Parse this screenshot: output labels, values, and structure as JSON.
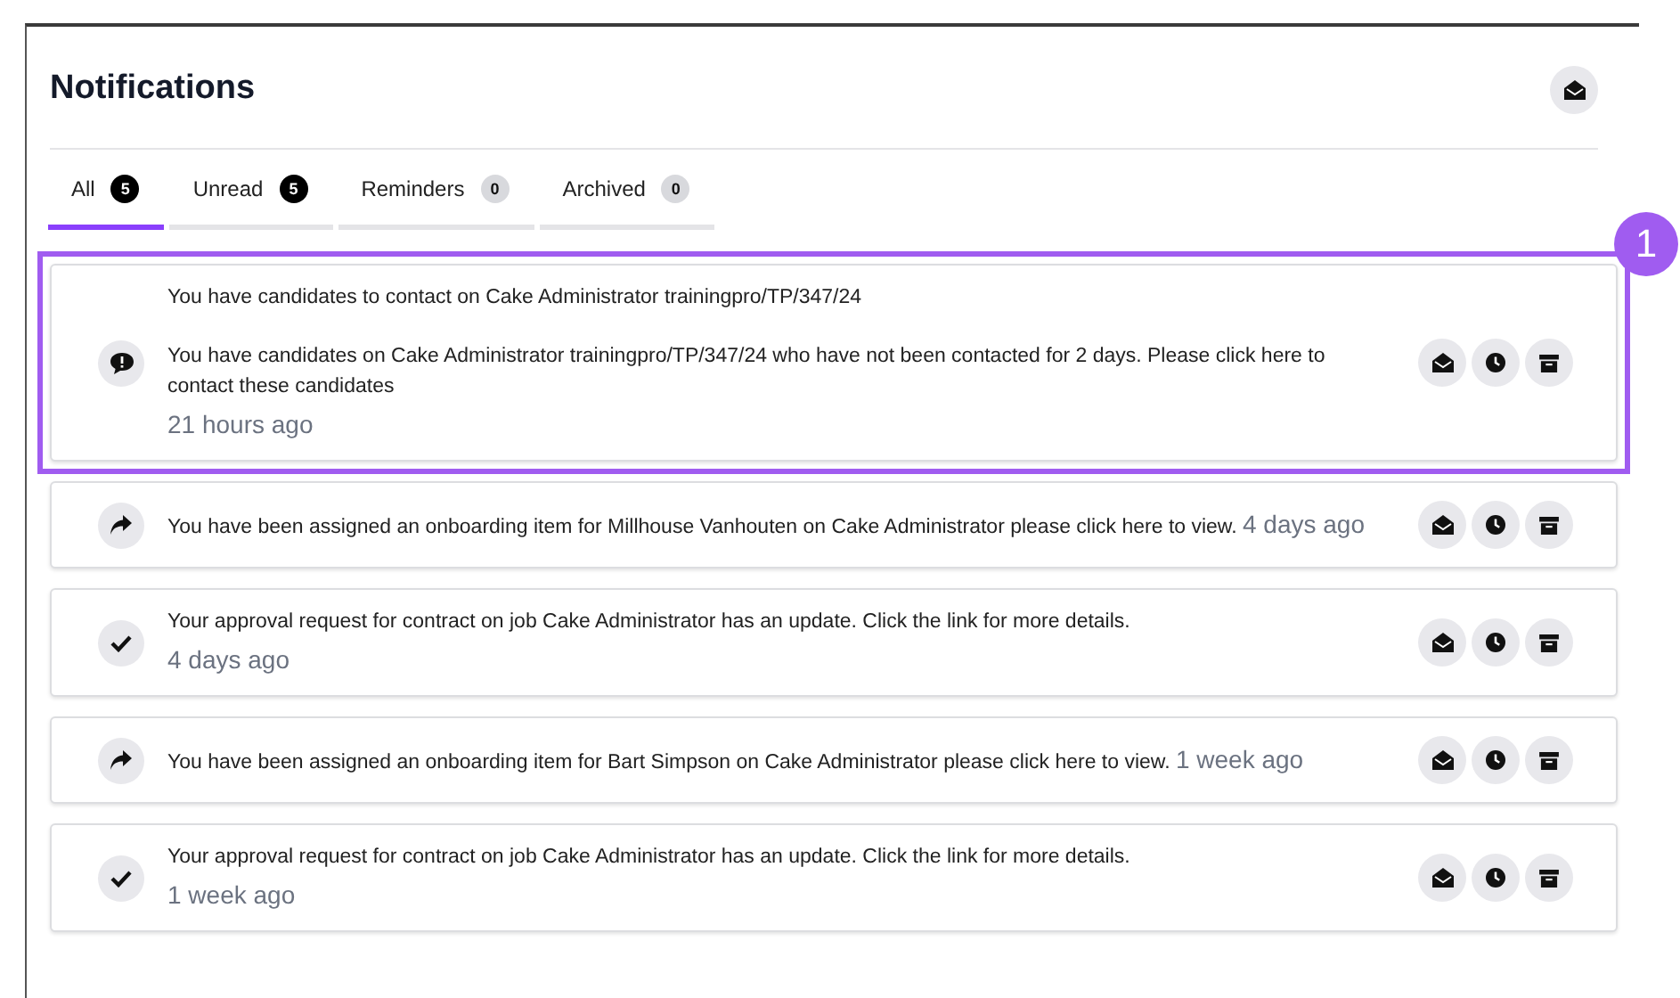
{
  "header": {
    "title": "Notifications"
  },
  "tabs": [
    {
      "label": "All",
      "count": "5",
      "emphasized": true,
      "selected": true
    },
    {
      "label": "Unread",
      "count": "5",
      "emphasized": true,
      "selected": false
    },
    {
      "label": "Reminders",
      "count": "0",
      "emphasized": false,
      "selected": false
    },
    {
      "label": "Archived",
      "count": "0",
      "emphasized": false,
      "selected": false
    }
  ],
  "notifications": [
    {
      "kind": "chat",
      "title": "You have candidates to contact on Cake Administrator trainingpro/TP/347/24",
      "message": "You have candidates on Cake Administrator trainingpro/TP/347/24 who have not been contacted for 2 days. Please click here to contact these candidates",
      "time": "21 hours ago",
      "time_on_own_line": true,
      "highlighted": true,
      "callout": "1"
    },
    {
      "kind": "assigned",
      "message": "You have been assigned an onboarding item for Millhouse Vanhouten on Cake Administrator please click here to view.",
      "time": "4 days ago",
      "time_on_own_line": false,
      "highlighted": false
    },
    {
      "kind": "approval",
      "message": "Your approval request for contract on job Cake Administrator has an update. Click the link for more details.",
      "time": "4 days ago",
      "time_on_own_line": true,
      "highlighted": false
    },
    {
      "kind": "assigned",
      "message": "You have been assigned an onboarding item for Bart Simpson on Cake Administrator please click here to view.",
      "time": "1 week ago",
      "time_on_own_line": false,
      "highlighted": false
    },
    {
      "kind": "approval",
      "message": "Your approval request for contract on job Cake Administrator has an update. Click the link for more details.",
      "time": "1 week ago",
      "time_on_own_line": true,
      "highlighted": false
    }
  ]
}
